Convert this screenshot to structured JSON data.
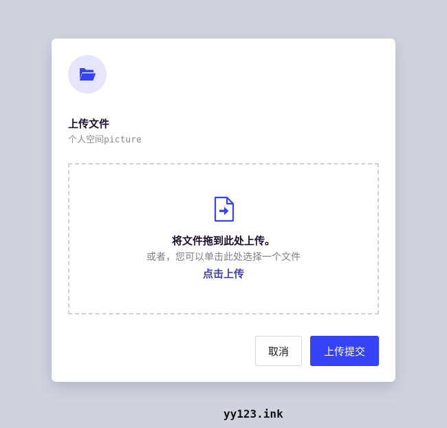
{
  "modal": {
    "title": "上传文件",
    "subtitle": "个人空间picture",
    "header_icon": "folder-open-icon",
    "dropzone": {
      "icon": "file-upload-icon",
      "main_text": "将文件拖到此处上传。",
      "sub_text": "或者，您可以单击此处选择一个文件",
      "link_text": "点击上传"
    },
    "buttons": {
      "cancel_label": "取消",
      "submit_label": "上传提交"
    }
  },
  "watermark": "yy123.ink",
  "colors": {
    "background": "#d0d2de",
    "accent": "#3542f5",
    "icon_circle": "#e6e5fb",
    "link": "#3d3fb8"
  }
}
